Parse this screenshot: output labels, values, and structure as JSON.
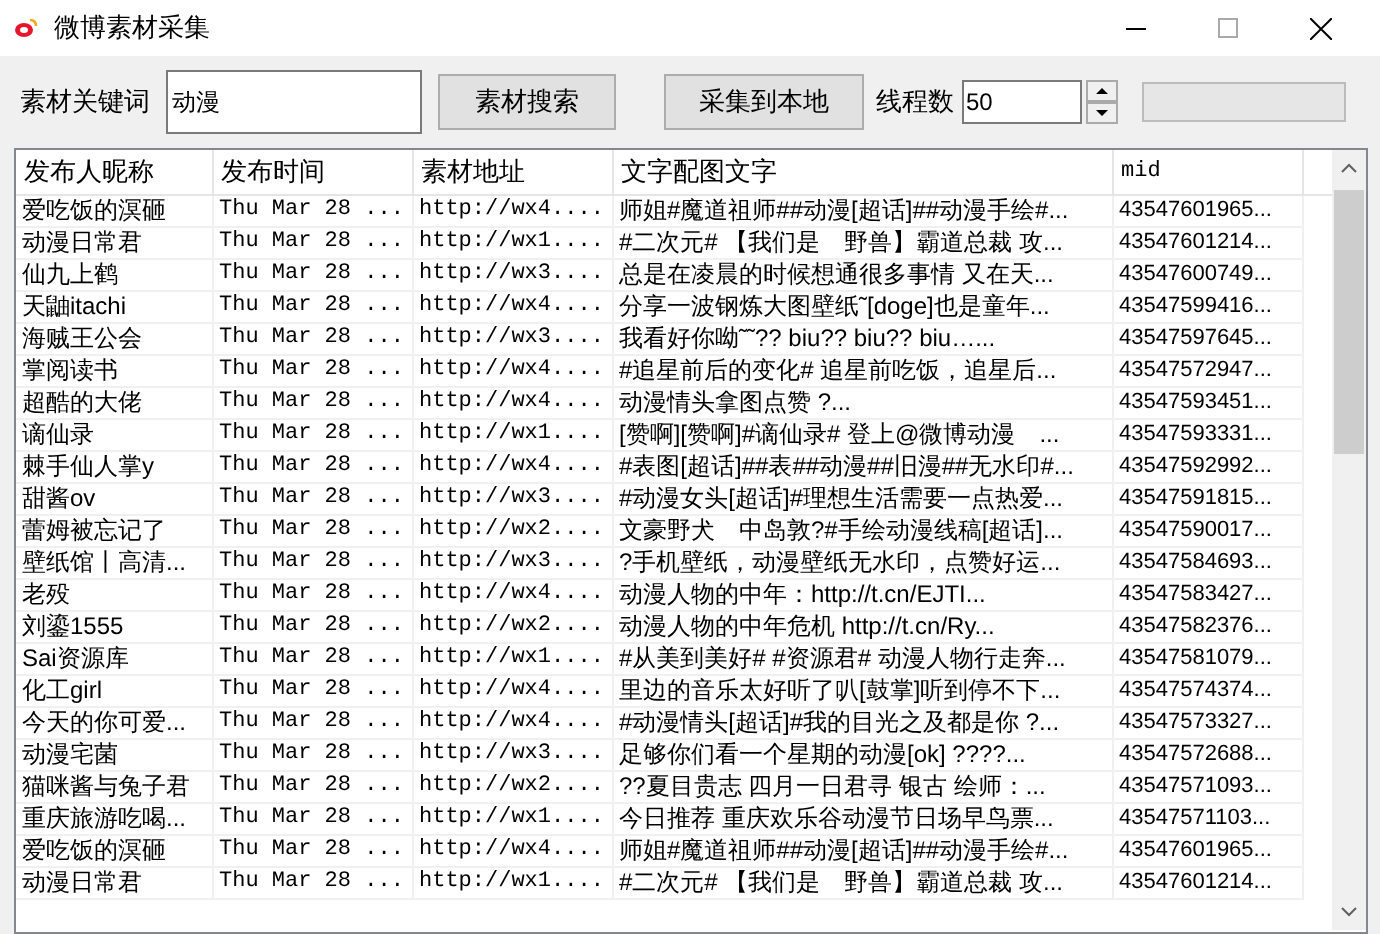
{
  "window": {
    "title": "微博素材采集"
  },
  "toolbar": {
    "keyword_label": "素材关键词",
    "keyword_value": "动漫",
    "search_button": "素材搜索",
    "collect_button": "采集到本地",
    "threads_label": "线程数",
    "threads_value": "50",
    "progress": {
      "level": 0
    }
  },
  "table": {
    "columns": [
      "发布人昵称",
      "发布时间",
      "素材地址",
      "文字配图文字",
      "mid"
    ],
    "rows": [
      [
        "爱吃饭的溟砸",
        "Thu Mar 28 ...",
        "http://wx4....",
        "师姐#魔道祖师##动漫[超话]##动漫手绘#...",
        "43547601965..."
      ],
      [
        "动漫日常君",
        "Thu Mar 28 ...",
        "http://wx1....",
        "#二次元# 【我们是　野兽】霸道总裁 攻...",
        "43547601214..."
      ],
      [
        "仙九上鹤",
        "Thu Mar 28 ...",
        "http://wx3....",
        "总是在凌晨的时候想通很多事情 又在天...",
        "43547600749..."
      ],
      [
        "天鼬itachi",
        "Thu Mar 28 ...",
        "http://wx4....",
        "分享一波钢炼大图壁纸˜[doge]也是童年...",
        "43547599416..."
      ],
      [
        "海贼王公会",
        "Thu Mar 28 ...",
        "http://wx3....",
        "我看好你呦˜˜?? biu?? biu?? biu…...",
        "43547597645..."
      ],
      [
        "掌阅读书",
        "Thu Mar 28 ...",
        "http://wx4....",
        "#追星前后的变化# 追星前吃饭，追星后...",
        "43547572947..."
      ],
      [
        "超酷的大佬",
        "Thu Mar 28 ...",
        "http://wx4....",
        "动漫情头拿图点赞 ?...",
        "43547593451..."
      ],
      [
        "谪仙录",
        "Thu Mar 28 ...",
        "http://wx1....",
        "[赞啊][赞啊]#谪仙录# 登上@微博动漫　...",
        "43547593331..."
      ],
      [
        "棘手仙人掌y",
        "Thu Mar 28 ...",
        "http://wx4....",
        "#表图[超话]##表##动漫##旧漫##无水印#...",
        "43547592992..."
      ],
      [
        "甜酱ov",
        "Thu Mar 28 ...",
        "http://wx3....",
        "#动漫女头[超话]#理想生活需要一点热爱...",
        "43547591815..."
      ],
      [
        "蕾姆被忘记了",
        "Thu Mar 28 ...",
        "http://wx2....",
        "文豪野犬　中岛敦?#手绘动漫线稿[超话]...",
        "43547590017..."
      ],
      [
        "壁纸馆丨高清...",
        "Thu Mar 28 ...",
        "http://wx3....",
        "?手机壁纸，动漫壁纸无水印，点赞好运...",
        "43547584693..."
      ],
      [
        "老殁",
        "Thu Mar 28 ...",
        "http://wx4....",
        "动漫人物的中年：http://t.cn/EJTI...",
        "43547583427..."
      ],
      [
        "刘鎏1555",
        "Thu Mar 28 ...",
        "http://wx2....",
        "动漫人物的中年危机 http://t.cn/Ry...",
        "43547582376..."
      ],
      [
        "Sai资源库",
        "Thu Mar 28 ...",
        "http://wx1....",
        "#从美到美好# #资源君# 动漫人物行走奔...",
        "43547581079..."
      ],
      [
        "化工girl",
        "Thu Mar 28 ...",
        "http://wx4....",
        "里边的音乐太好听了叭[鼓掌]听到停不下...",
        "43547574374..."
      ],
      [
        "今天的你可爱...",
        "Thu Mar 28 ...",
        "http://wx4....",
        "#动漫情头[超话]#我的目光之及都是你 ?...",
        "43547573327..."
      ],
      [
        "动漫宅菌",
        "Thu Mar 28 ...",
        "http://wx3....",
        "足够你们看一个星期的动漫[ok] ????...",
        "43547572688..."
      ],
      [
        "猫咪酱与兔子君",
        "Thu Mar 28 ...",
        "http://wx2....",
        "??夏目贵志 四月一日君寻 银古 绘师：...",
        "43547571093..."
      ],
      [
        "重庆旅游吃喝...",
        "Thu Mar 28 ...",
        "http://wx1....",
        "今日推荐 重庆欢乐谷动漫节日场早鸟票...",
        "43547571103..."
      ],
      [
        "爱吃饭的溟砸",
        "Thu Mar 28 ...",
        "http://wx4....",
        "师姐#魔道祖师##动漫[超话]##动漫手绘#...",
        "43547601965..."
      ],
      [
        "动漫日常君",
        "Thu Mar 28 ...",
        "http://wx1....",
        "#二次元# 【我们是　野兽】霸道总裁 攻...",
        "43547601214..."
      ]
    ]
  }
}
